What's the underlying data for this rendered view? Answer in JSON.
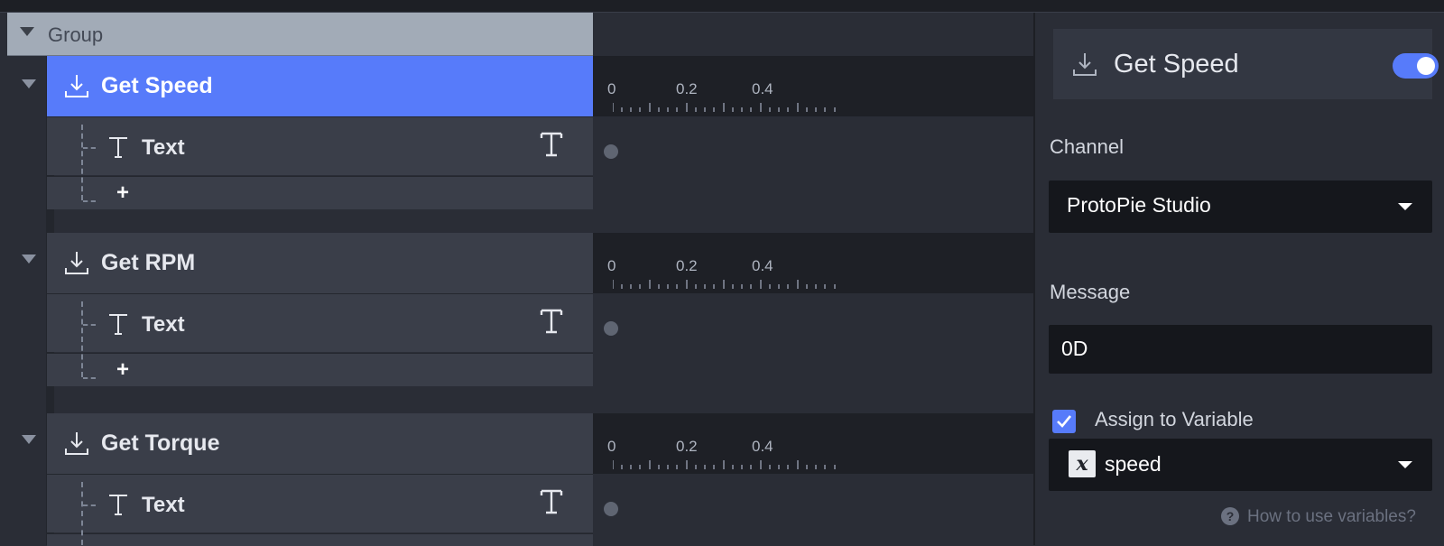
{
  "group": {
    "label": "Group"
  },
  "triggers": [
    {
      "label": "Get Speed",
      "response": "Text",
      "active": true
    },
    {
      "label": "Get RPM",
      "response": "Text",
      "active": false
    },
    {
      "label": "Get Torque",
      "response": "Text",
      "active": false
    }
  ],
  "add_symbol": "+",
  "timeline": {
    "ticks": [
      "0",
      "0.2",
      "0.4"
    ]
  },
  "inspector": {
    "title": "Get Speed",
    "toggle_on": true,
    "channel_label": "Channel",
    "channel_value": "ProtoPie Studio",
    "message_label": "Message",
    "message_value": "0D",
    "assign_label": "Assign to Variable",
    "assign_checked": true,
    "variable_icon_glyph": "x",
    "variable_value": "speed",
    "help_glyph": "?",
    "help_text": "How to use variables?"
  },
  "colors": {
    "accent": "#577bfa",
    "group_bar": "#a2abb7",
    "row": "#3a3e49",
    "field": "#15171c"
  }
}
